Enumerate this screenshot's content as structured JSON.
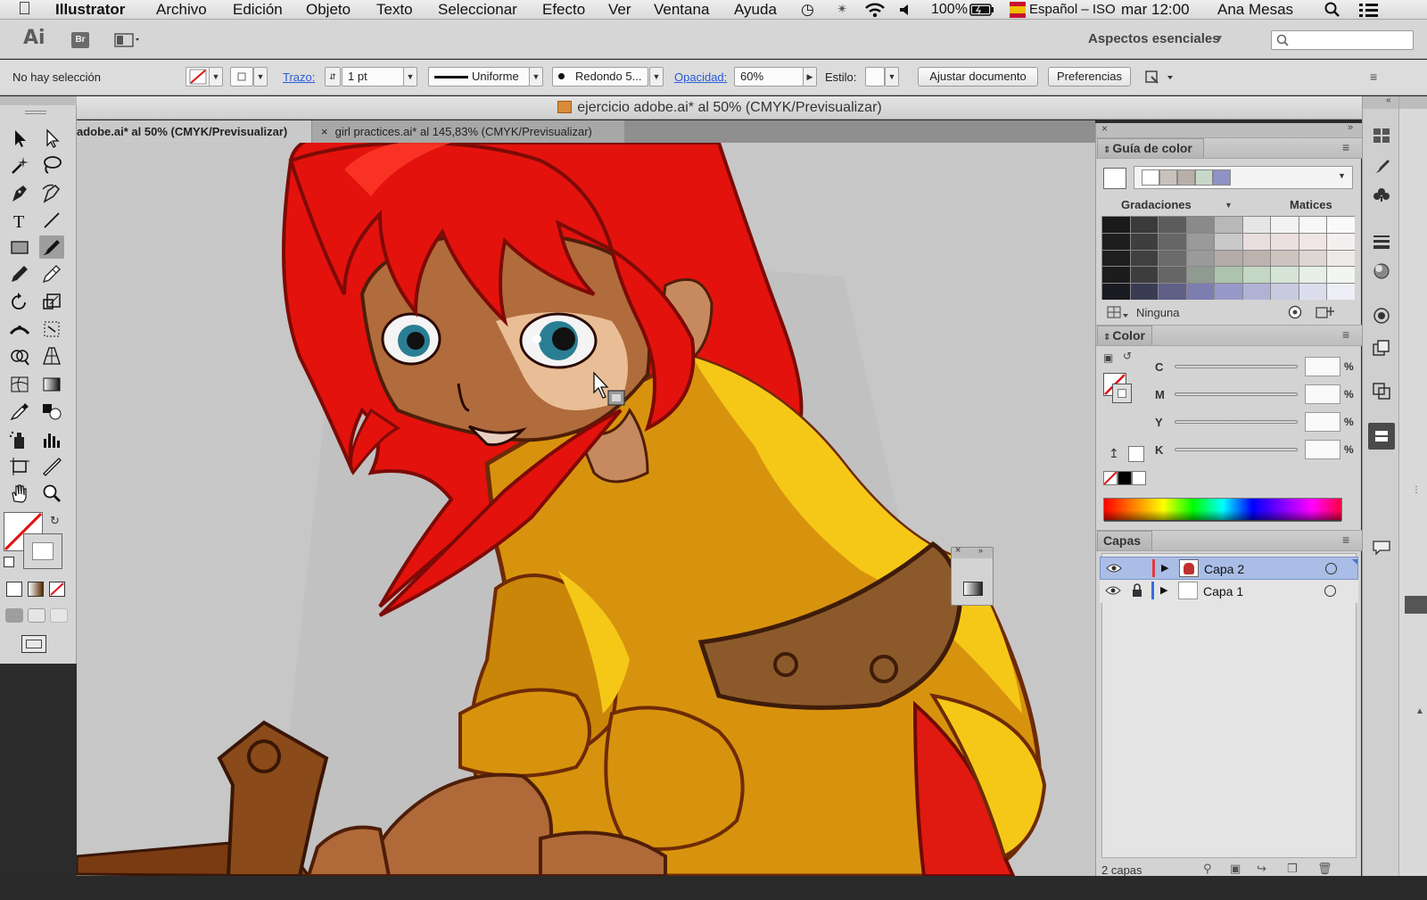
{
  "menubar": {
    "app": "Illustrator",
    "items": [
      "Archivo",
      "Edición",
      "Objeto",
      "Texto",
      "Seleccionar",
      "Efecto",
      "Ver",
      "Ventana",
      "Ayuda"
    ],
    "battery": "100%",
    "input_source": "Español – ISO",
    "clock": "mar 12:00",
    "user": "Ana Mesas"
  },
  "appbar": {
    "logo": "Ai",
    "bridge": "Br",
    "workspace": "Aspectos esenciales",
    "search_placeholder": ""
  },
  "controlbar": {
    "selection": "No hay selección",
    "stroke_label": "Trazo:",
    "stroke_weight": "1 pt",
    "profile": "Uniforme",
    "brush": "Redondo 5...",
    "opacity_label": "Opacidad:",
    "opacity": "60%",
    "style_label": "Estilo:",
    "doc_setup": "Ajustar documento",
    "preferences": "Preferencias"
  },
  "document": {
    "window_title": "ejercicio adobe.ai* al 50% (CMYK/Previsualizar)",
    "tabs": [
      {
        "label": "adobe.ai* al 50% (CMYK/Previsualizar)",
        "active": true
      },
      {
        "label": "girl practices.ai* al 145,83% (CMYK/Previsualizar)",
        "active": false
      }
    ]
  },
  "color_guide": {
    "title": "Guía de color",
    "variations": "Gradaciones",
    "swatches_label": "Matices",
    "none_label": "Ninguna",
    "harmony": [
      "#ffffff",
      "#c8c2bc",
      "#b8b0a8",
      "#c7d8c8",
      "#8f92c4"
    ],
    "grid_colors": [
      [
        "#1a1a1a",
        "#3a3a3a",
        "#5c5c5c",
        "#8a8a8a",
        "#b8b8b8",
        "#e6e6e6",
        "#f2f2f2",
        "#f7f7f7",
        "#fafafa"
      ],
      [
        "#1d1d1d",
        "#3e3e3e",
        "#666666",
        "#9a9a9a",
        "#c9c9c9",
        "#e9dede",
        "#ebdfdf",
        "#f0e6e6",
        "#f5f0f0"
      ],
      [
        "#1e1e1e",
        "#404040",
        "#6b6b6b",
        "#9a9a9a",
        "#b3aca8",
        "#bcb2ae",
        "#cdc4c0",
        "#ddd6d2",
        "#eeeae8"
      ],
      [
        "#1c1c1c",
        "#3d3d3d",
        "#666666",
        "#8f9a90",
        "#adc3ad",
        "#c4d6c4",
        "#d6e4d6",
        "#e7f0e7",
        "#f1f6f1"
      ],
      [
        "#1a1a22",
        "#3b3b55",
        "#5f5f88",
        "#7c7eb0",
        "#9698c8",
        "#b0b2d4",
        "#c8cae0",
        "#dddeed",
        "#eeeef6"
      ]
    ]
  },
  "color_panel": {
    "title": "Color",
    "channels": [
      "C",
      "M",
      "Y",
      "K"
    ],
    "unit": "%"
  },
  "layers_panel": {
    "title": "Capas",
    "layers": [
      {
        "name": "Capa 2",
        "color": "#e03a3a",
        "locked": false,
        "selected": true
      },
      {
        "name": "Capa 1",
        "color": "#3a6be0",
        "locked": true,
        "selected": false
      }
    ],
    "status": "2 capas"
  }
}
